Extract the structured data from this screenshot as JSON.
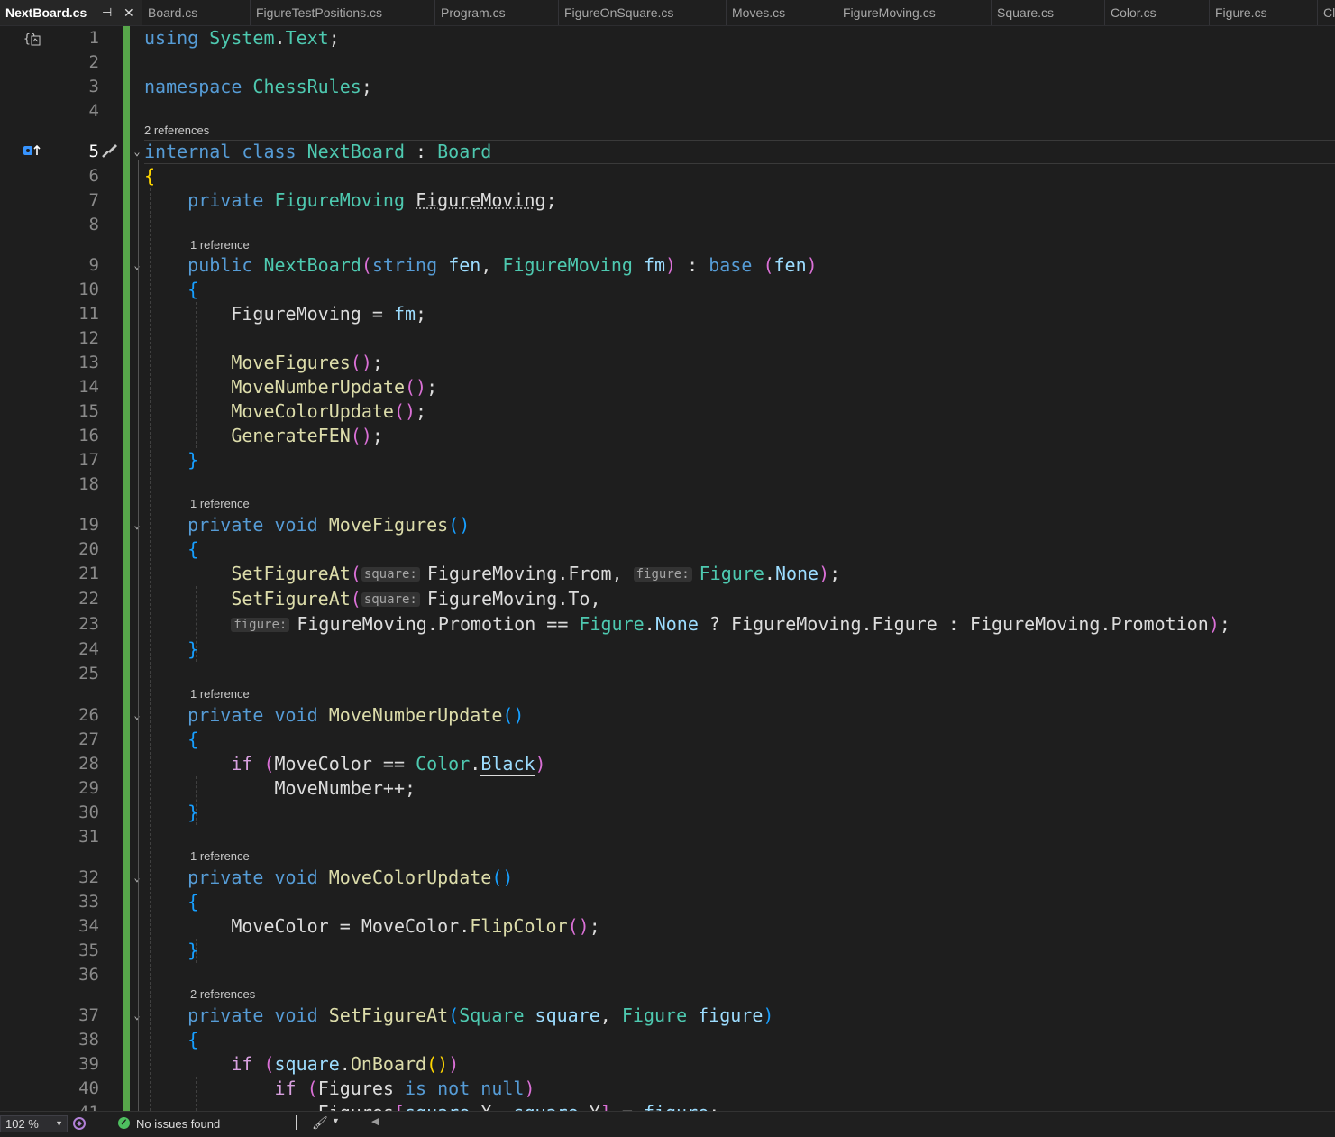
{
  "tabs": [
    {
      "label": "NextBoard.cs",
      "active": true
    },
    {
      "label": "Board.cs"
    },
    {
      "label": "FigureTestPositions.cs"
    },
    {
      "label": "Program.cs"
    },
    {
      "label": "FigureOnSquare.cs"
    },
    {
      "label": "Moves.cs"
    },
    {
      "label": "FigureMoving.cs"
    },
    {
      "label": "Square.cs"
    },
    {
      "label": "Color.cs"
    },
    {
      "label": "Figure.cs"
    },
    {
      "label": "Cl"
    }
  ],
  "tab_pin_icon": "pin-icon",
  "tab_close_icon": "close-icon",
  "editor": {
    "current_line": 5,
    "line_numbers": [
      "1",
      "2",
      "3",
      "4",
      "5",
      "6",
      "7",
      "8",
      "9",
      "10",
      "11",
      "12",
      "13",
      "14",
      "15",
      "16",
      "17",
      "18",
      "19",
      "20",
      "21",
      "22",
      "23",
      "24",
      "25",
      "26",
      "27",
      "28",
      "29",
      "30",
      "31",
      "32",
      "33",
      "34",
      "35",
      "36",
      "37",
      "38",
      "39",
      "40",
      "41"
    ],
    "code_lens": [
      "2 references",
      "1 reference",
      "1 reference",
      "1 reference",
      "1 reference",
      "2 references"
    ],
    "inlay_hints": {
      "square": "square:",
      "figure": "figure:"
    }
  },
  "status": {
    "zoom": "102 %",
    "issues": "No issues found"
  },
  "colors": {
    "keyword": "#569cd6",
    "type": "#4ec9b0",
    "method": "#dcdcaa",
    "parameter": "#9cdcfe",
    "control": "#d8a0df",
    "change_bar": "#57a64a",
    "background": "#1e1e1e"
  }
}
